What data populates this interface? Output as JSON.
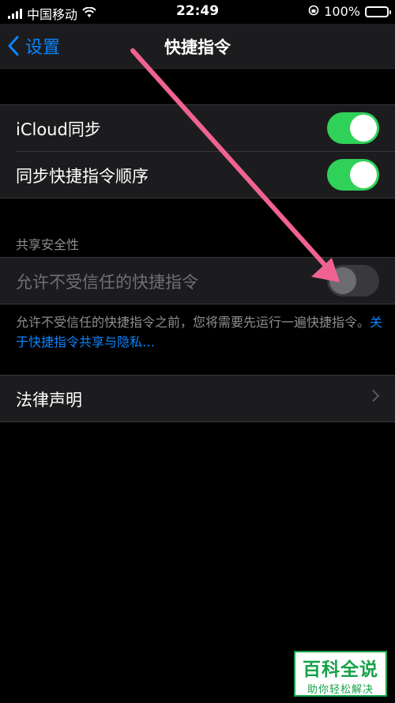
{
  "status_bar": {
    "carrier": "中国移动",
    "time": "22:49",
    "battery": "100%"
  },
  "nav": {
    "back_label": "设置",
    "title": "快捷指令"
  },
  "sync_group": {
    "items": [
      {
        "label": "iCloud同步",
        "on": true
      },
      {
        "label": "同步快捷指令顺序",
        "on": true
      }
    ]
  },
  "security": {
    "header": "共享安全性",
    "item": {
      "label": "允许不受信任的快捷指令",
      "on": false
    },
    "footer_text": "允许不受信任的快捷指令之前，您将需要先运行一遍快捷指令。",
    "footer_link": "关于快捷指令共享与隐私…"
  },
  "legal": {
    "label": "法律声明"
  },
  "watermark": {
    "line1": "百科全说",
    "line2": "助你轻松解决"
  },
  "colors": {
    "accent": "#0a84ff",
    "toggle_on": "#30d158",
    "arrow": "#f06292"
  }
}
